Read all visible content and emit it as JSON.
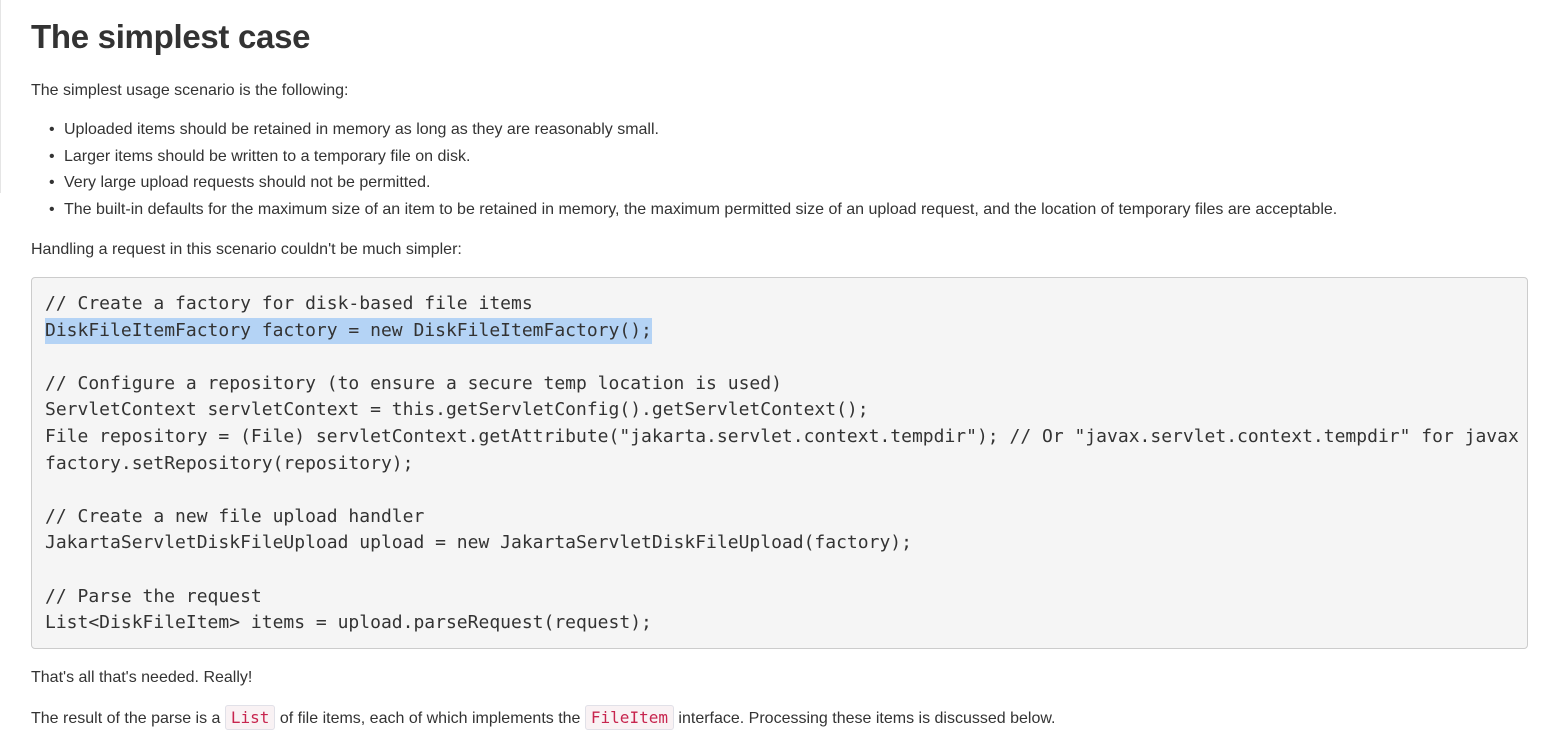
{
  "heading": "The simplest case",
  "intro": "The simplest usage scenario is the following:",
  "bullets": [
    "Uploaded items should be retained in memory as long as they are reasonably small.",
    "Larger items should be written to a temporary file on disk.",
    "Very large upload requests should not be permitted.",
    "The built-in defaults for the maximum size of an item to be retained in memory, the maximum permitted size of an upload request, and the location of temporary files are acceptable."
  ],
  "handling_text": "Handling a request in this scenario couldn't be much simpler:",
  "code_lines": [
    "// Create a factory for disk-based file items",
    "DiskFileItemFactory factory = new DiskFileItemFactory();",
    "",
    "// Configure a repository (to ensure a secure temp location is used)",
    "ServletContext servletContext = this.getServletConfig().getServletContext();",
    "File repository = (File) servletContext.getAttribute(\"jakarta.servlet.context.tempdir\"); // Or \"javax.servlet.context.tempdir\" for javax",
    "factory.setRepository(repository);",
    "",
    "// Create a new file upload handler",
    "JakartaServletDiskFileUpload upload = new JakartaServletDiskFileUpload(factory);",
    "",
    "// Parse the request",
    "List<DiskFileItem> items = upload.parseRequest(request);"
  ],
  "thats_all": "That's all that's needed. Really!",
  "result": {
    "prefix": "The result of the parse is a",
    "code1": "List",
    "middle": "of file items, each of which implements the",
    "code2": "FileItem",
    "suffix": "interface. Processing these items is discussed below."
  },
  "colors": {
    "text": "#333333",
    "code_background": "#f5f5f5",
    "selection": "#b4d3f5",
    "inline_code": "#c7254e"
  }
}
